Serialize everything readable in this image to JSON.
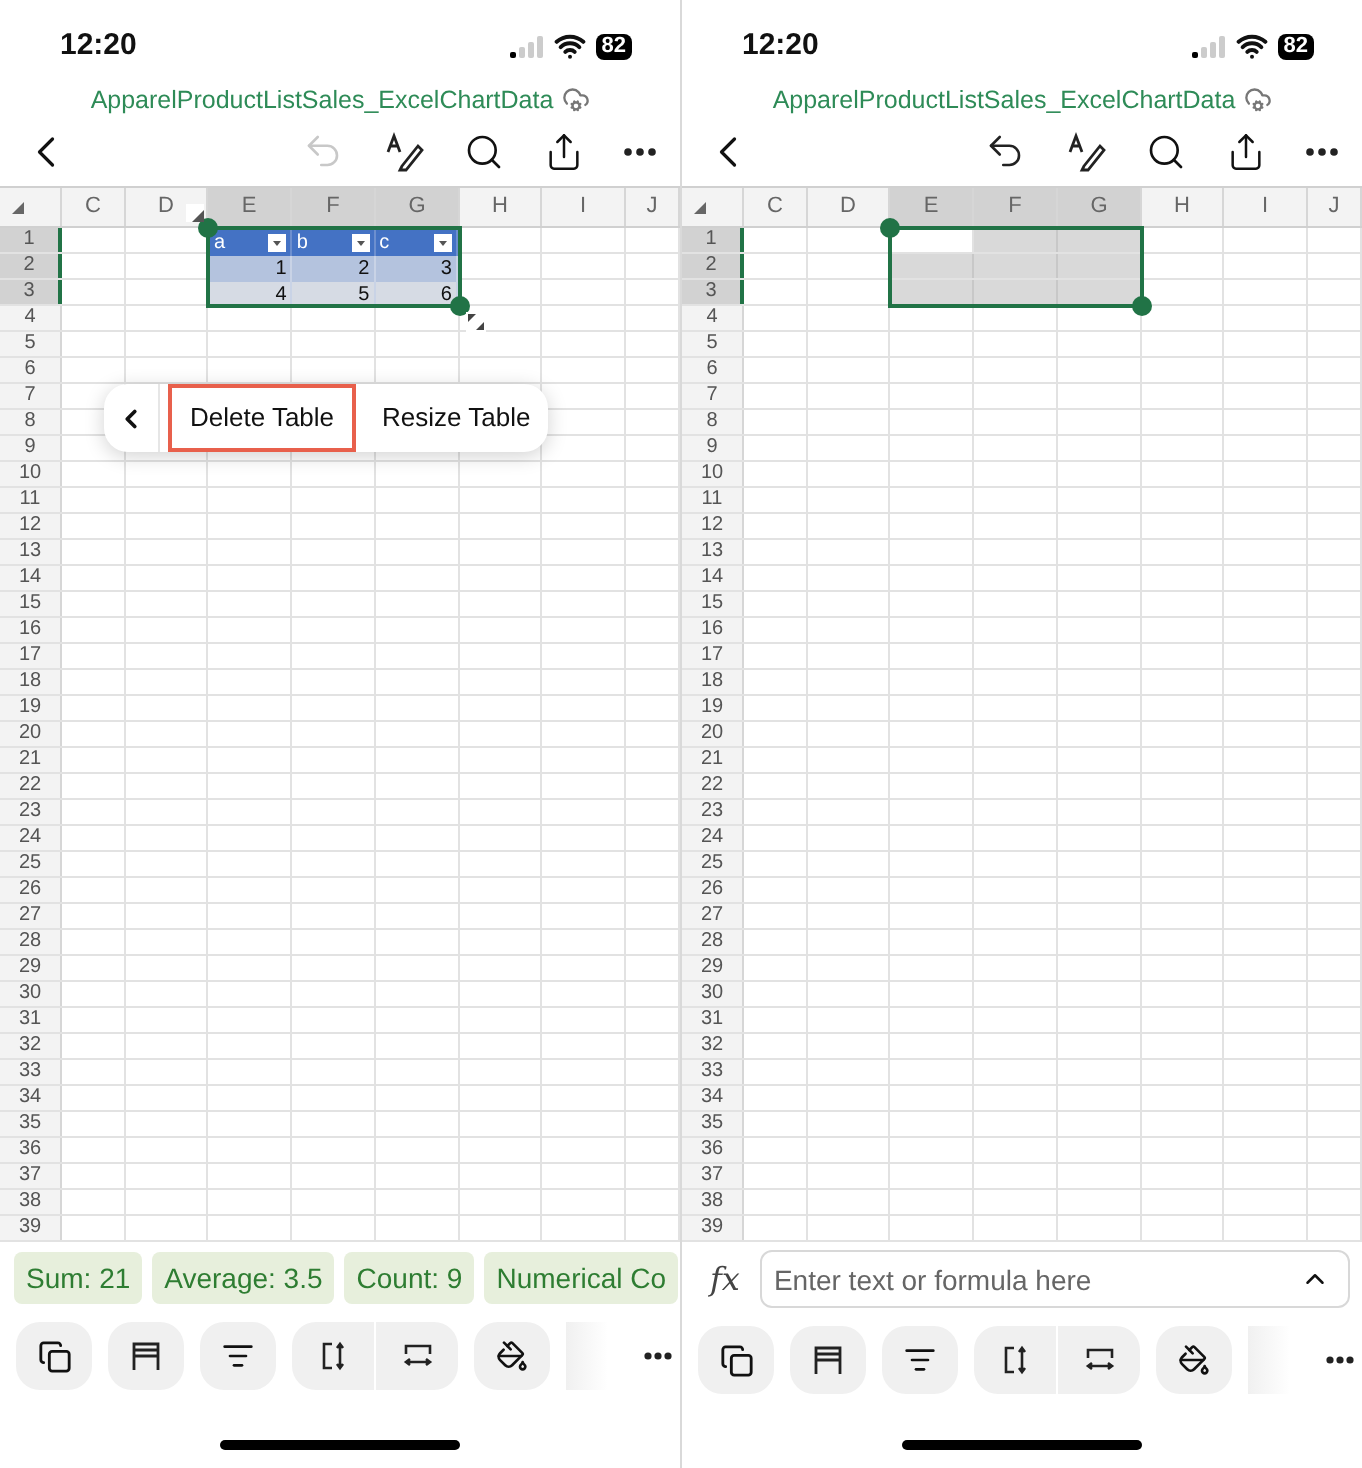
{
  "panels": [
    {
      "status": {
        "time": "12:20",
        "battery": "82"
      },
      "title": "ApparelProductListSales_ExcelChartData",
      "undo_enabled": false,
      "columns": [
        {
          "label": "C",
          "selected": false
        },
        {
          "label": "D",
          "selected": false
        },
        {
          "label": "E",
          "selected": true
        },
        {
          "label": "F",
          "selected": true
        },
        {
          "label": "G",
          "selected": true
        },
        {
          "label": "H",
          "selected": false
        },
        {
          "label": "I",
          "selected": false
        },
        {
          "label": "J",
          "selected": false
        }
      ],
      "rows": [
        {
          "label": "1",
          "selected": true
        },
        {
          "label": "2",
          "selected": true
        },
        {
          "label": "3",
          "selected": true
        },
        {
          "label": "4",
          "selected": false
        },
        {
          "label": "5",
          "selected": false
        },
        {
          "label": "6",
          "selected": false
        },
        {
          "label": "7",
          "selected": false
        },
        {
          "label": "8",
          "selected": false
        },
        {
          "label": "9",
          "selected": false
        },
        {
          "label": "10",
          "selected": false
        },
        {
          "label": "11",
          "selected": false
        },
        {
          "label": "12",
          "selected": false
        },
        {
          "label": "13",
          "selected": false
        },
        {
          "label": "14",
          "selected": false
        },
        {
          "label": "15",
          "selected": false
        },
        {
          "label": "16",
          "selected": false
        },
        {
          "label": "17",
          "selected": false
        },
        {
          "label": "18",
          "selected": false
        },
        {
          "label": "19",
          "selected": false
        },
        {
          "label": "20",
          "selected": false
        },
        {
          "label": "21",
          "selected": false
        },
        {
          "label": "22",
          "selected": false
        },
        {
          "label": "23",
          "selected": false
        },
        {
          "label": "24",
          "selected": false
        },
        {
          "label": "25",
          "selected": false
        },
        {
          "label": "26",
          "selected": false
        },
        {
          "label": "27",
          "selected": false
        },
        {
          "label": "28",
          "selected": false
        },
        {
          "label": "29",
          "selected": false
        },
        {
          "label": "30",
          "selected": false
        },
        {
          "label": "31",
          "selected": false
        },
        {
          "label": "32",
          "selected": false
        },
        {
          "label": "33",
          "selected": false
        },
        {
          "label": "34",
          "selected": false
        },
        {
          "label": "35",
          "selected": false
        },
        {
          "label": "36",
          "selected": false
        },
        {
          "label": "37",
          "selected": false
        },
        {
          "label": "38",
          "selected": false
        },
        {
          "label": "39",
          "selected": false
        }
      ],
      "range_shaded": false,
      "table": {
        "headers": [
          "a",
          "b",
          "c"
        ],
        "rows": [
          [
            "1",
            "2",
            "3"
          ],
          [
            "4",
            "5",
            "6"
          ]
        ]
      },
      "popup_menu": [
        {
          "kind": "back",
          "highlighted": false
        },
        {
          "kind": "item",
          "label": "Delete Table",
          "highlighted": true
        },
        {
          "kind": "item",
          "label": "Resize Table",
          "highlighted": false
        }
      ],
      "summary": [
        "Sum: 21",
        "Average: 3.5",
        "Count: 9",
        "Numerical Co"
      ]
    },
    {
      "status": {
        "time": "12:20",
        "battery": "82"
      },
      "title": "ApparelProductListSales_ExcelChartData",
      "undo_enabled": true,
      "columns": [
        {
          "label": "C",
          "selected": false
        },
        {
          "label": "D",
          "selected": false
        },
        {
          "label": "E",
          "selected": true
        },
        {
          "label": "F",
          "selected": true
        },
        {
          "label": "G",
          "selected": true
        },
        {
          "label": "H",
          "selected": false
        },
        {
          "label": "I",
          "selected": false
        },
        {
          "label": "J",
          "selected": false
        }
      ],
      "rows": [
        {
          "label": "1",
          "selected": true
        },
        {
          "label": "2",
          "selected": true
        },
        {
          "label": "3",
          "selected": true
        },
        {
          "label": "4",
          "selected": false
        },
        {
          "label": "5",
          "selected": false
        },
        {
          "label": "6",
          "selected": false
        },
        {
          "label": "7",
          "selected": false
        },
        {
          "label": "8",
          "selected": false
        },
        {
          "label": "9",
          "selected": false
        },
        {
          "label": "10",
          "selected": false
        },
        {
          "label": "11",
          "selected": false
        },
        {
          "label": "12",
          "selected": false
        },
        {
          "label": "13",
          "selected": false
        },
        {
          "label": "14",
          "selected": false
        },
        {
          "label": "15",
          "selected": false
        },
        {
          "label": "16",
          "selected": false
        },
        {
          "label": "17",
          "selected": false
        },
        {
          "label": "18",
          "selected": false
        },
        {
          "label": "19",
          "selected": false
        },
        {
          "label": "20",
          "selected": false
        },
        {
          "label": "21",
          "selected": false
        },
        {
          "label": "22",
          "selected": false
        },
        {
          "label": "23",
          "selected": false
        },
        {
          "label": "24",
          "selected": false
        },
        {
          "label": "25",
          "selected": false
        },
        {
          "label": "26",
          "selected": false
        },
        {
          "label": "27",
          "selected": false
        },
        {
          "label": "28",
          "selected": false
        },
        {
          "label": "29",
          "selected": false
        },
        {
          "label": "30",
          "selected": false
        },
        {
          "label": "31",
          "selected": false
        },
        {
          "label": "32",
          "selected": false
        },
        {
          "label": "33",
          "selected": false
        },
        {
          "label": "34",
          "selected": false
        },
        {
          "label": "35",
          "selected": false
        },
        {
          "label": "36",
          "selected": false
        },
        {
          "label": "37",
          "selected": false
        },
        {
          "label": "38",
          "selected": false
        },
        {
          "label": "39",
          "selected": false
        }
      ],
      "range_shaded": true,
      "formula_bar": {
        "icon": "fx",
        "placeholder": "Enter text or formula here"
      }
    }
  ]
}
